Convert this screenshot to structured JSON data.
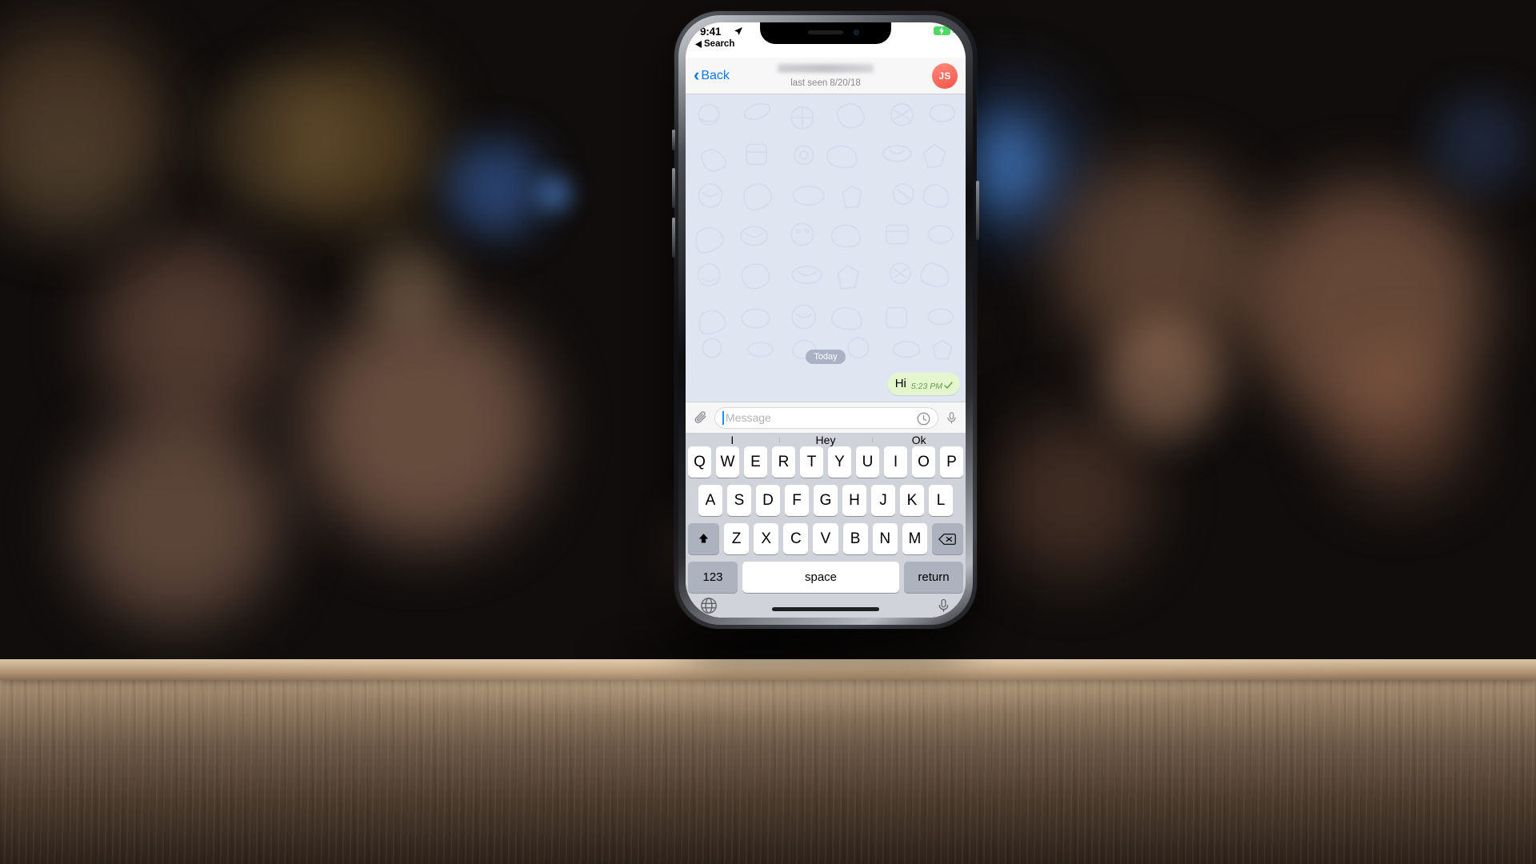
{
  "scene": {
    "description": "iPhone X mockup on wooden table with bokeh background",
    "background_type": "bokeh-night-lights",
    "table_color": "#9c8468"
  },
  "status_bar": {
    "time": "9:41",
    "location_icon": "location-arrow-icon",
    "back_to_app_label": "Search",
    "back_arrow_icon": "triangle-left-icon",
    "battery_icon": "battery-charging-icon",
    "battery_color": "#4cd964"
  },
  "chat_header": {
    "back_label": "Back",
    "back_icon": "chevron-left-icon",
    "title_redacted": true,
    "subtitle": "last seen 8/20/18",
    "avatar_initials": "JS",
    "avatar_color": "#f2564a",
    "accent_color": "#0b78ee"
  },
  "chat": {
    "day_badge": "Today",
    "messages": [
      {
        "text": "Hi",
        "time": "5:23 PM",
        "status_icon": "single-check-icon",
        "direction": "outgoing",
        "bubble_color": "#e3f6cd"
      }
    ]
  },
  "input_bar": {
    "attach_icon": "paperclip-icon",
    "placeholder": "Message",
    "value": "",
    "schedule_icon": "clock-icon",
    "voice_icon": "microphone-icon"
  },
  "keyboard": {
    "suggestions": [
      "I",
      "Hey",
      "Ok"
    ],
    "row1": [
      "Q",
      "W",
      "E",
      "R",
      "T",
      "Y",
      "U",
      "I",
      "O",
      "P"
    ],
    "row2": [
      "A",
      "S",
      "D",
      "F",
      "G",
      "H",
      "J",
      "K",
      "L"
    ],
    "row3": [
      "Z",
      "X",
      "C",
      "V",
      "B",
      "N",
      "M"
    ],
    "shift_icon": "shift-arrow-up-icon",
    "backspace_icon": "backspace-icon",
    "numbers_label": "123",
    "space_label": "space",
    "return_label": "return",
    "globe_icon": "globe-icon",
    "dictation_icon": "microphone-icon"
  }
}
